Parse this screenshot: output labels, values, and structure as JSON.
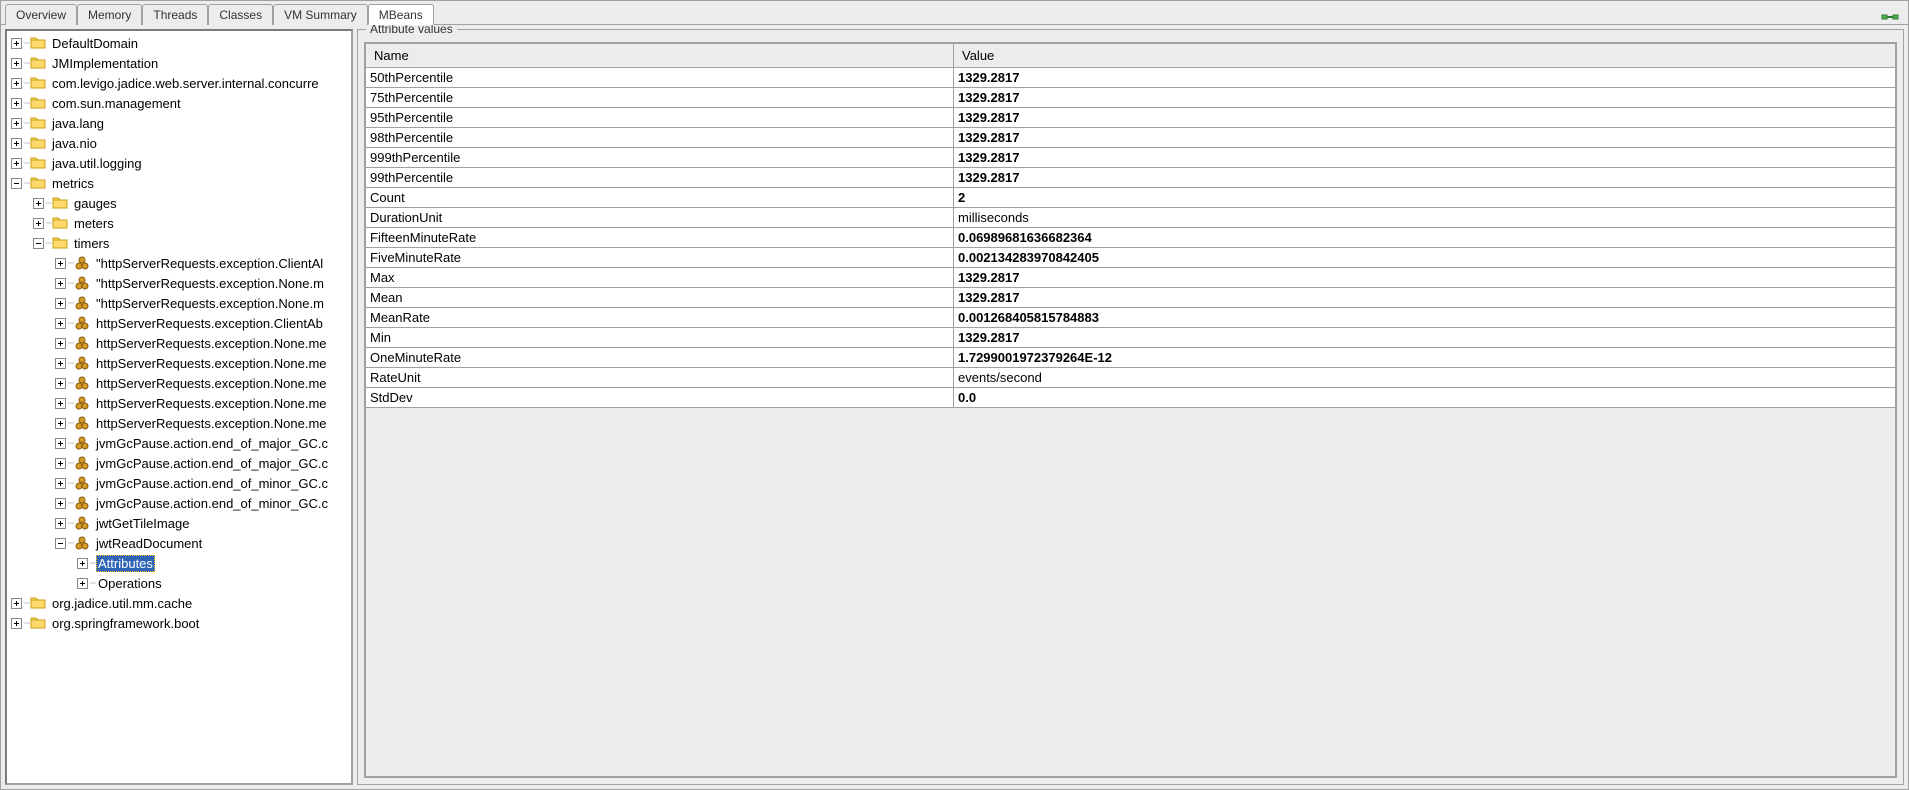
{
  "tabs": {
    "items": [
      {
        "label": "Overview"
      },
      {
        "label": "Memory"
      },
      {
        "label": "Threads"
      },
      {
        "label": "Classes"
      },
      {
        "label": "VM Summary"
      },
      {
        "label": "MBeans"
      }
    ],
    "activeIndex": 5
  },
  "tree": [
    {
      "depth": 0,
      "toggle": "plus",
      "icon": "folder",
      "label": "DefaultDomain"
    },
    {
      "depth": 0,
      "toggle": "plus",
      "icon": "folder",
      "label": "JMImplementation"
    },
    {
      "depth": 0,
      "toggle": "plus",
      "icon": "folder",
      "label": "com.levigo.jadice.web.server.internal.concurre"
    },
    {
      "depth": 0,
      "toggle": "plus",
      "icon": "folder",
      "label": "com.sun.management"
    },
    {
      "depth": 0,
      "toggle": "plus",
      "icon": "folder",
      "label": "java.lang"
    },
    {
      "depth": 0,
      "toggle": "plus",
      "icon": "folder",
      "label": "java.nio"
    },
    {
      "depth": 0,
      "toggle": "plus",
      "icon": "folder",
      "label": "java.util.logging"
    },
    {
      "depth": 0,
      "toggle": "minus",
      "icon": "folder",
      "label": "metrics"
    },
    {
      "depth": 1,
      "toggle": "plus",
      "icon": "folder",
      "label": "gauges"
    },
    {
      "depth": 1,
      "toggle": "plus",
      "icon": "folder",
      "label": "meters"
    },
    {
      "depth": 1,
      "toggle": "minus",
      "icon": "folder",
      "label": "timers"
    },
    {
      "depth": 2,
      "toggle": "plus",
      "icon": "bean",
      "label": "\"httpServerRequests.exception.ClientAl"
    },
    {
      "depth": 2,
      "toggle": "plus",
      "icon": "bean",
      "label": "\"httpServerRequests.exception.None.m"
    },
    {
      "depth": 2,
      "toggle": "plus",
      "icon": "bean",
      "label": "\"httpServerRequests.exception.None.m"
    },
    {
      "depth": 2,
      "toggle": "plus",
      "icon": "bean",
      "label": "httpServerRequests.exception.ClientAb"
    },
    {
      "depth": 2,
      "toggle": "plus",
      "icon": "bean",
      "label": "httpServerRequests.exception.None.me"
    },
    {
      "depth": 2,
      "toggle": "plus",
      "icon": "bean",
      "label": "httpServerRequests.exception.None.me"
    },
    {
      "depth": 2,
      "toggle": "plus",
      "icon": "bean",
      "label": "httpServerRequests.exception.None.me"
    },
    {
      "depth": 2,
      "toggle": "plus",
      "icon": "bean",
      "label": "httpServerRequests.exception.None.me"
    },
    {
      "depth": 2,
      "toggle": "plus",
      "icon": "bean",
      "label": "httpServerRequests.exception.None.me"
    },
    {
      "depth": 2,
      "toggle": "plus",
      "icon": "bean",
      "label": "jvmGcPause.action.end_of_major_GC.c"
    },
    {
      "depth": 2,
      "toggle": "plus",
      "icon": "bean",
      "label": "jvmGcPause.action.end_of_major_GC.c"
    },
    {
      "depth": 2,
      "toggle": "plus",
      "icon": "bean",
      "label": "jvmGcPause.action.end_of_minor_GC.c"
    },
    {
      "depth": 2,
      "toggle": "plus",
      "icon": "bean",
      "label": "jvmGcPause.action.end_of_minor_GC.c"
    },
    {
      "depth": 2,
      "toggle": "plus",
      "icon": "bean",
      "label": "jwtGetTileImage"
    },
    {
      "depth": 2,
      "toggle": "minus",
      "icon": "bean",
      "label": "jwtReadDocument"
    },
    {
      "depth": 3,
      "toggle": "plus",
      "icon": "none",
      "label": "Attributes",
      "selected": true
    },
    {
      "depth": 3,
      "toggle": "plus",
      "icon": "none",
      "label": "Operations"
    },
    {
      "depth": 0,
      "toggle": "plus",
      "icon": "folder",
      "label": "org.jadice.util.mm.cache"
    },
    {
      "depth": 0,
      "toggle": "plus",
      "icon": "folder",
      "label": "org.springframework.boot"
    }
  ],
  "detail": {
    "title": "Attribute values",
    "columns": {
      "name": "Name",
      "value": "Value"
    },
    "rows": [
      {
        "name": "50thPercentile",
        "value": "1329.2817",
        "bold": true
      },
      {
        "name": "75thPercentile",
        "value": "1329.2817",
        "bold": true
      },
      {
        "name": "95thPercentile",
        "value": "1329.2817",
        "bold": true
      },
      {
        "name": "98thPercentile",
        "value": "1329.2817",
        "bold": true
      },
      {
        "name": "999thPercentile",
        "value": "1329.2817",
        "bold": true
      },
      {
        "name": "99thPercentile",
        "value": "1329.2817",
        "bold": true
      },
      {
        "name": "Count",
        "value": "2",
        "bold": true
      },
      {
        "name": "DurationUnit",
        "value": "milliseconds",
        "bold": false
      },
      {
        "name": "FifteenMinuteRate",
        "value": "0.06989681636682364",
        "bold": true
      },
      {
        "name": "FiveMinuteRate",
        "value": "0.002134283970842405",
        "bold": true
      },
      {
        "name": "Max",
        "value": "1329.2817",
        "bold": true
      },
      {
        "name": "Mean",
        "value": "1329.2817",
        "bold": true
      },
      {
        "name": "MeanRate",
        "value": "0.001268405815784883",
        "bold": true
      },
      {
        "name": "Min",
        "value": "1329.2817",
        "bold": true
      },
      {
        "name": "OneMinuteRate",
        "value": "1.7299001972379264E-12",
        "bold": true
      },
      {
        "name": "RateUnit",
        "value": "events/second",
        "bold": false
      },
      {
        "name": "StdDev",
        "value": "0.0",
        "bold": true
      }
    ]
  }
}
